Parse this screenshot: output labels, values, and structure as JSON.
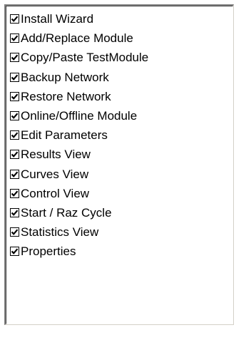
{
  "items": [
    {
      "label": "Install Wizard",
      "checked": true
    },
    {
      "label": "Add/Replace Module",
      "checked": true
    },
    {
      "label": "Copy/Paste TestModule",
      "checked": true
    },
    {
      "label": "Backup Network",
      "checked": true
    },
    {
      "label": "Restore Network",
      "checked": true
    },
    {
      "label": "Online/Offline Module",
      "checked": true
    },
    {
      "label": "Edit Parameters",
      "checked": true
    },
    {
      "label": "Results View",
      "checked": true
    },
    {
      "label": "Curves View",
      "checked": true
    },
    {
      "label": "Control View",
      "checked": true
    },
    {
      "label": "Start / Raz Cycle",
      "checked": true
    },
    {
      "label": "Statistics View",
      "checked": true
    },
    {
      "label": "Properties",
      "checked": true
    }
  ]
}
